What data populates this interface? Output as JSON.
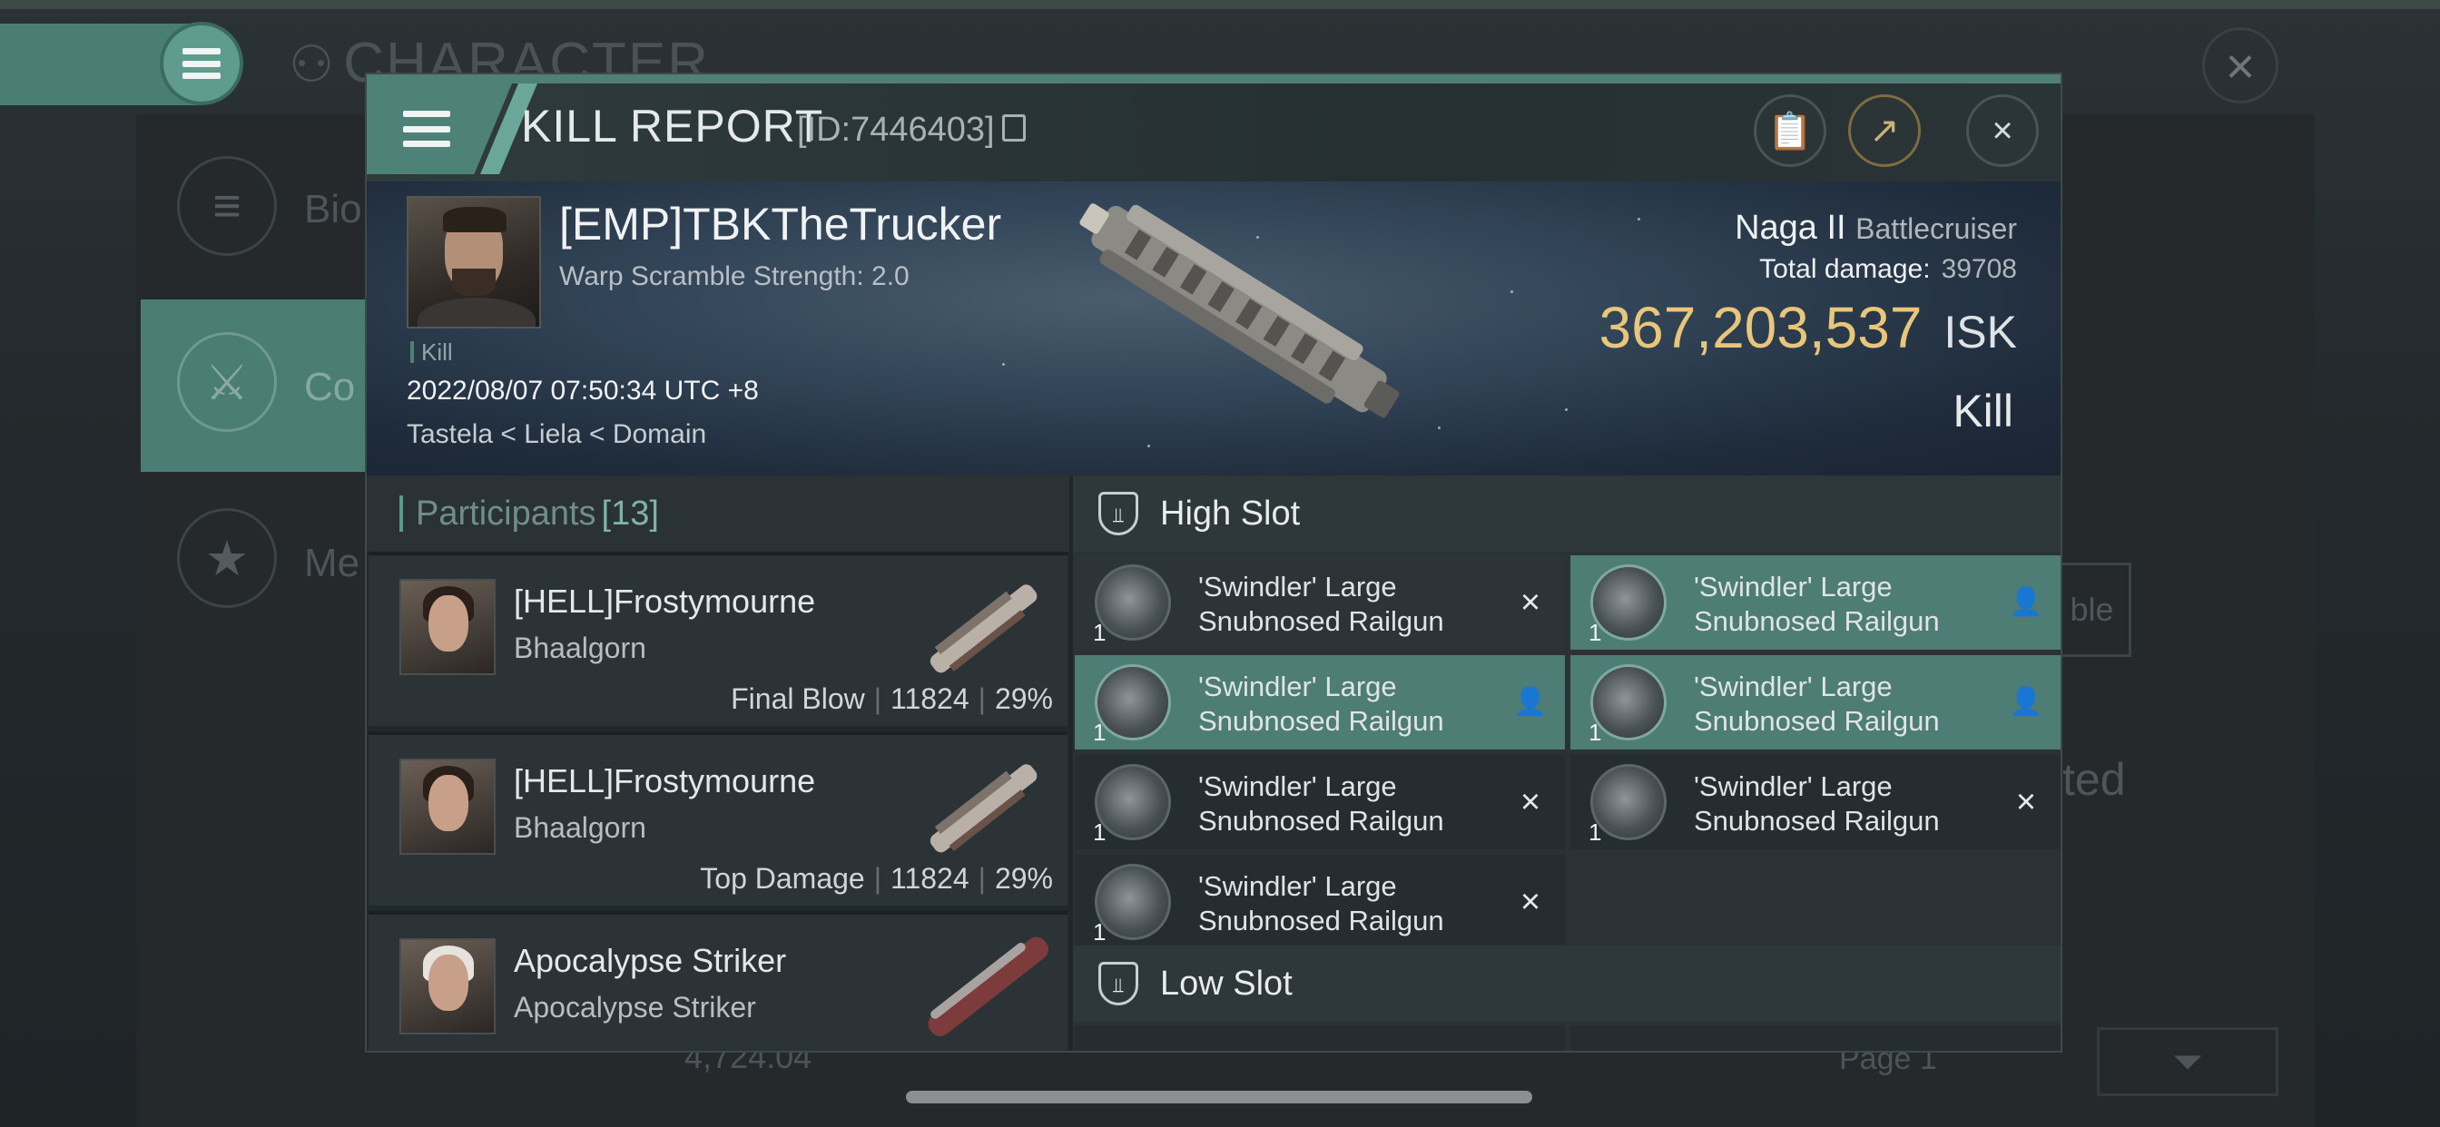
{
  "background": {
    "title": "CHARACTER",
    "side_items": [
      "Bio",
      "Co",
      "Me"
    ],
    "right_text_1": "ble",
    "right_text_2": "ted",
    "bottom_value": "4,724.04",
    "bottom_page": "Page 1"
  },
  "modal": {
    "title": "KILL REPORT",
    "id": "[ID:7446403]",
    "victim": {
      "name": "[EMP]TBKTheTrucker",
      "warp_scramble": "Warp Scramble Strength: 2.0",
      "tag": "Kill",
      "datetime": "2022/08/07 07:50:34 UTC +8",
      "location": "Tastela < Liela < Domain"
    },
    "ship": {
      "name": "Naga II",
      "class": "Battlecruiser",
      "damage_label": "Total damage:",
      "damage_value": "39708",
      "isk_value": "367,203,537",
      "isk_unit": "ISK",
      "result": "Kill"
    },
    "participants": {
      "label": "Participants",
      "count": "[13]",
      "rows": [
        {
          "name": "[HELL]Frostymourne",
          "corp": "Bhaalgorn",
          "role": "Final Blow",
          "damage": "11824",
          "percent": "29%"
        },
        {
          "name": "[HELL]Frostymourne",
          "corp": "Bhaalgorn",
          "role": "Top Damage",
          "damage": "11824",
          "percent": "29%"
        },
        {
          "name": "Apocalypse Striker",
          "corp": "Apocalypse Striker",
          "role": "",
          "damage": "",
          "percent": ""
        }
      ]
    },
    "high_slot": {
      "label": "High Slot",
      "modules": [
        {
          "name_1": "'Swindler' Large",
          "name_2": "Snubnosed Railgun",
          "qty": "1",
          "status": "destroyed"
        },
        {
          "name_1": "'Swindler' Large",
          "name_2": "Snubnosed Railgun",
          "qty": "1",
          "status": "dropped"
        },
        {
          "name_1": "'Swindler' Large",
          "name_2": "Snubnosed Railgun",
          "qty": "1",
          "status": "dropped"
        },
        {
          "name_1": "'Swindler' Large",
          "name_2": "Snubnosed Railgun",
          "qty": "1",
          "status": "dropped"
        },
        {
          "name_1": "'Swindler' Large",
          "name_2": "Snubnosed Railgun",
          "qty": "1",
          "status": "destroyed"
        },
        {
          "name_1": "'Swindler' Large",
          "name_2": "Snubnosed Railgun",
          "qty": "1",
          "status": "destroyed"
        },
        {
          "name_1": "'Swindler' Large",
          "name_2": "Snubnosed Railgun",
          "qty": "1",
          "status": "destroyed"
        }
      ]
    },
    "low_slot": {
      "label": "Low Slot"
    },
    "icons": {
      "destroyed": "×",
      "dropped": "👤"
    },
    "colors": {
      "accent": "#4e8177",
      "isk": "#e8c67a",
      "selected": "#4d7d74"
    }
  }
}
